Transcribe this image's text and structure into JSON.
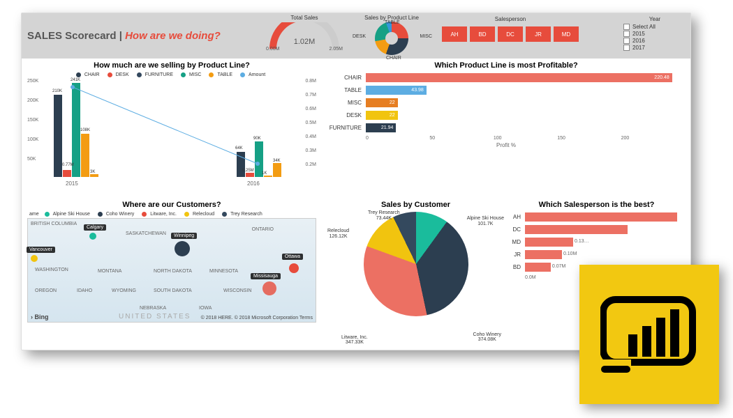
{
  "header": {
    "title_prefix": "SALES Scorecard | ",
    "title_question": "How are we doing?",
    "total_sales_label": "Total Sales",
    "total_sales_value": "1.02M",
    "total_sales_min": "0.00M",
    "total_sales_max": "2.05M",
    "donut_label": "Sales by Product Line",
    "donut_labels": {
      "top": "TABLE",
      "right": "MISC",
      "bottom": "CHAIR",
      "left": "DESK"
    },
    "salesperson_label": "Salesperson",
    "salespersons": [
      "AH",
      "BD",
      "DC",
      "JR",
      "MD"
    ],
    "year_label": "Year",
    "years": [
      "Select All",
      "2015",
      "2016",
      "2017"
    ]
  },
  "colors": {
    "chair": "#2c3e50",
    "desk": "#e74c3c",
    "furniture": "#34495e",
    "misc": "#16a085",
    "table": "#f39c12",
    "amount": "#5dade2",
    "salmon": "#ec7063",
    "yellow": "#f1c40f",
    "teal": "#1abc9c"
  },
  "panel1": {
    "title": "How much are we selling by Product Line?",
    "legend": [
      "CHAIR",
      "DESK",
      "FURNITURE",
      "MISC",
      "TABLE",
      "Amount"
    ]
  },
  "panel2": {
    "title": "Which Product Line is most Profitable?",
    "xlabel": "Profit %"
  },
  "panel3": {
    "title": "Where are our Customers?",
    "legend_prefix": "ame",
    "legend": [
      "Alpine Ski House",
      "Coho Winery",
      "Litware, Inc.",
      "Relecloud",
      "Trey Research"
    ],
    "cities": [
      "Calgary",
      "Winnipeg",
      "Vancouver",
      "Ottawa",
      "Missisauga"
    ],
    "regions": [
      "BRITISH COLUMBIA",
      "SASKATCHEWAN",
      "ONTARIO",
      "WASHINGTON",
      "MONTANA",
      "NORTH DAKOTA",
      "MINNESOTA",
      "OREGON",
      "IDAHO",
      "WYOMING",
      "SOUTH DAKOTA",
      "WISCONSIN",
      "NEBRASKA",
      "IOWA",
      "UNITED STATES"
    ],
    "bing": "› Bing",
    "attribution": "© 2018 HERE. © 2018 Microsoft Corporation  Terms"
  },
  "panel4": {
    "title": "Sales by Customer"
  },
  "panel5": {
    "title": "Which Salesperson is the best?"
  },
  "chart_data": [
    {
      "id": "product_line_bars",
      "type": "bar",
      "title": "How much are we selling by Product Line?",
      "categories": [
        "2015",
        "2016"
      ],
      "series": [
        {
          "name": "CHAIR",
          "values": [
            210000,
            64000
          ],
          "labels": [
            "210K",
            "64K"
          ]
        },
        {
          "name": "DESK",
          "values": [
            null,
            null
          ],
          "labels": [
            "0.77M",
            "0.25M"
          ]
        },
        {
          "name": "FURNITURE",
          "values": [
            241000,
            90000
          ],
          "labels": [
            "241K",
            "90K"
          ]
        },
        {
          "name": "MISC",
          "values": [
            108000,
            1000
          ],
          "labels": [
            "108K",
            "1K"
          ]
        },
        {
          "name": "TABLE",
          "values": [
            3000,
            34000
          ],
          "labels": [
            "3K",
            "34K"
          ]
        },
        {
          "name": "Amount",
          "values": [
            770000,
            250000
          ],
          "type": "line"
        }
      ],
      "ylim_left": [
        0,
        250000
      ],
      "yticks_left": [
        "50K",
        "100K",
        "150K",
        "200K",
        "250K"
      ],
      "ylim_right": [
        200000,
        800000
      ],
      "yticks_right": [
        "0.2M",
        "0.3M",
        "0.4M",
        "0.5M",
        "0.6M",
        "0.7M",
        "0.8M"
      ]
    },
    {
      "id": "profit_by_line",
      "type": "bar",
      "orientation": "horizontal",
      "title": "Which Product Line is most Profitable?",
      "xlabel": "Profit %",
      "categories": [
        "CHAIR",
        "TABLE",
        "MISC",
        "DESK",
        "FURNITURE"
      ],
      "values": [
        220.48,
        43.98,
        22.0,
        22.0,
        21.94
      ],
      "colors": [
        "#ec7063",
        "#5dade2",
        "#e67e22",
        "#f1c40f",
        "#2c3e50"
      ],
      "xlim": [
        0,
        230
      ],
      "xticks": [
        "0",
        "50",
        "100",
        "150",
        "200"
      ]
    },
    {
      "id": "sales_by_customer",
      "type": "pie",
      "title": "Sales by Customer",
      "slices": [
        {
          "name": "Alpine Ski House",
          "value": 101700,
          "label": "Alpine Ski House\n101.7K",
          "color": "#1abc9c"
        },
        {
          "name": "Coho Winery",
          "value": 374080,
          "label": "Coho Winery\n374.08K",
          "color": "#2c3e50"
        },
        {
          "name": "Litware, Inc.",
          "value": 347330,
          "label": "Litware, Inc.\n347.33K",
          "color": "#ec7063"
        },
        {
          "name": "Relecloud",
          "value": 126120,
          "label": "Relecloud\n126.12K",
          "color": "#f1c40f"
        },
        {
          "name": "Trey Research",
          "value": 73440,
          "label": "Trey Research\n73.44K",
          "color": "#34495e"
        }
      ]
    },
    {
      "id": "salesperson_best",
      "type": "bar",
      "orientation": "horizontal",
      "title": "Which Salesperson is the best?",
      "categories": [
        "AH",
        "DC",
        "MD",
        "JR",
        "BD"
      ],
      "values": [
        0.42,
        0.28,
        0.13,
        0.1,
        0.07
      ],
      "labels": [
        "",
        "",
        "0.13…",
        "0.10M",
        "0.07M"
      ],
      "color": "#ec7063",
      "xticks": [
        "0.0M"
      ]
    },
    {
      "id": "total_sales_gauge",
      "type": "gauge",
      "value": 1020000,
      "min": 0,
      "max": 2050000,
      "display": "1.02M",
      "min_display": "0.00M",
      "max_display": "2.05M"
    },
    {
      "id": "sales_by_product_donut",
      "type": "pie",
      "slices": [
        {
          "name": "TABLE"
        },
        {
          "name": "MISC"
        },
        {
          "name": "CHAIR"
        },
        {
          "name": "DESK"
        }
      ]
    }
  ]
}
